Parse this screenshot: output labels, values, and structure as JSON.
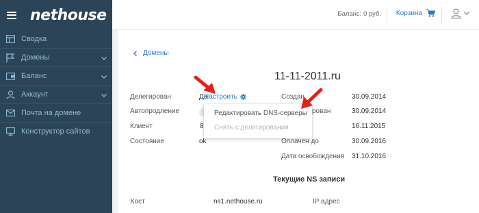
{
  "app": {
    "logo": "nethouse"
  },
  "sidebar": {
    "items": [
      {
        "label": "Сводка",
        "icon": "dashboard-icon",
        "has_chevron": false
      },
      {
        "label": "Домены",
        "icon": "flag-icon",
        "has_chevron": true
      },
      {
        "label": "Баланс",
        "icon": "wallet-icon",
        "has_chevron": true
      },
      {
        "label": "Аккаунт",
        "icon": "user-icon",
        "has_chevron": true
      },
      {
        "label": "Почта на домене",
        "icon": "mail-icon",
        "has_chevron": false
      },
      {
        "label": "Конструктор сайтов",
        "icon": "monitor-icon",
        "has_chevron": false
      }
    ]
  },
  "header": {
    "balance": "Баланс: 0 руб.",
    "cart_label": "Корзина"
  },
  "main": {
    "back_label": "Домены",
    "domain": "11-11-2011.ru",
    "left_fields": [
      {
        "label": "Делегирован",
        "value": "Да"
      },
      {
        "label": "Автопродление",
        "value": ""
      },
      {
        "label": "Клиент",
        "value": "8"
      },
      {
        "label": "Состояние",
        "value": "ok"
      }
    ],
    "configure_label": "Настроить",
    "right_fields": [
      {
        "label": "Создан",
        "value": "30.09.2014"
      },
      {
        "label": "рован",
        "value": "30.09.2014"
      },
      {
        "label": "",
        "value": "16.11.2015"
      },
      {
        "label": "Оплачен до",
        "value": "30.09.2016"
      },
      {
        "label": "Дата освобождения",
        "value": "31.10.2016"
      }
    ],
    "dropdown": {
      "items": [
        {
          "label": "Редактировать DNS-серверы",
          "enabled": true
        },
        {
          "label": "Снять с делегирования",
          "enabled": false
        }
      ]
    },
    "ns": {
      "title": "Текущие NS записи",
      "host_label": "Хост",
      "host_value": "ns1.nethouse.ru",
      "ip_label": "IP адрес"
    }
  },
  "colors": {
    "sidebar_bg": "#2c4457",
    "sidebar_text": "#8fb9d6",
    "accent": "#2b7ac9",
    "arrow": "#e8201a"
  }
}
